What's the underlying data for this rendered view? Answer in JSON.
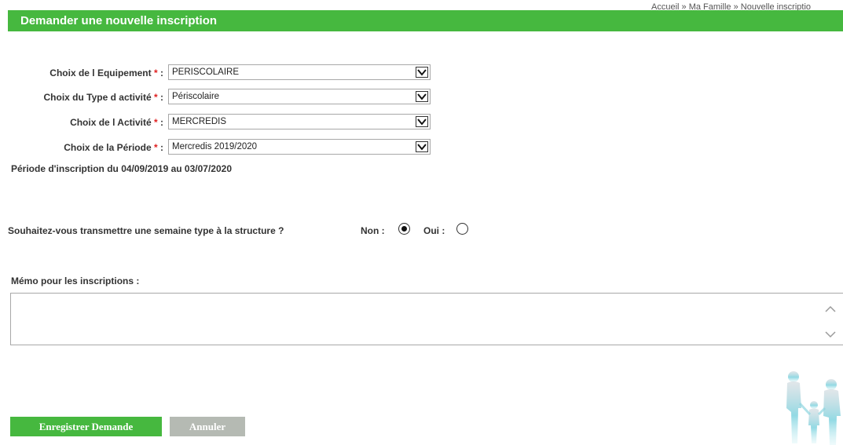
{
  "header": {
    "title": "Demander une nouvelle inscription",
    "breadcrumb": [
      "Accueil",
      "Ma Famille",
      "Nouvelle inscriptio"
    ],
    "breadcrumb_separator": "»"
  },
  "form": {
    "fields": [
      {
        "label": "Choix de l Equipement",
        "value": "PERISCOLAIRE"
      },
      {
        "label": "Choix du Type d activité",
        "value": "Périscolaire"
      },
      {
        "label": "Choix de l Activité",
        "value": "MERCREDIS"
      },
      {
        "label": "Choix de la Période",
        "value": "Mercredis 2019/2020"
      }
    ],
    "required_marker": "*",
    "label_suffix": ":",
    "period_text": "Période d'inscription du 04/09/2019 au 03/07/2020",
    "question": {
      "text": "Souhaitez-vous transmettre une semaine type à la structure ?",
      "options": [
        {
          "label": "Non :",
          "selected": true
        },
        {
          "label": "Oui :",
          "selected": false
        }
      ]
    },
    "memo_label": "Mémo pour les inscriptions :",
    "memo_value": ""
  },
  "buttons": {
    "save_label": "Enregistrer Demande",
    "cancel_label": "Annuler"
  },
  "colors": {
    "brand_green": "#46b83f",
    "cancel_gray": "#b5bab3",
    "required_red": "#e02020"
  },
  "icons": {
    "select_arrow": "chevron-down-icon",
    "scroll_up": "chevron-up-icon",
    "scroll_down": "chevron-down-icon",
    "decoration": "family-silhouette-icon"
  }
}
